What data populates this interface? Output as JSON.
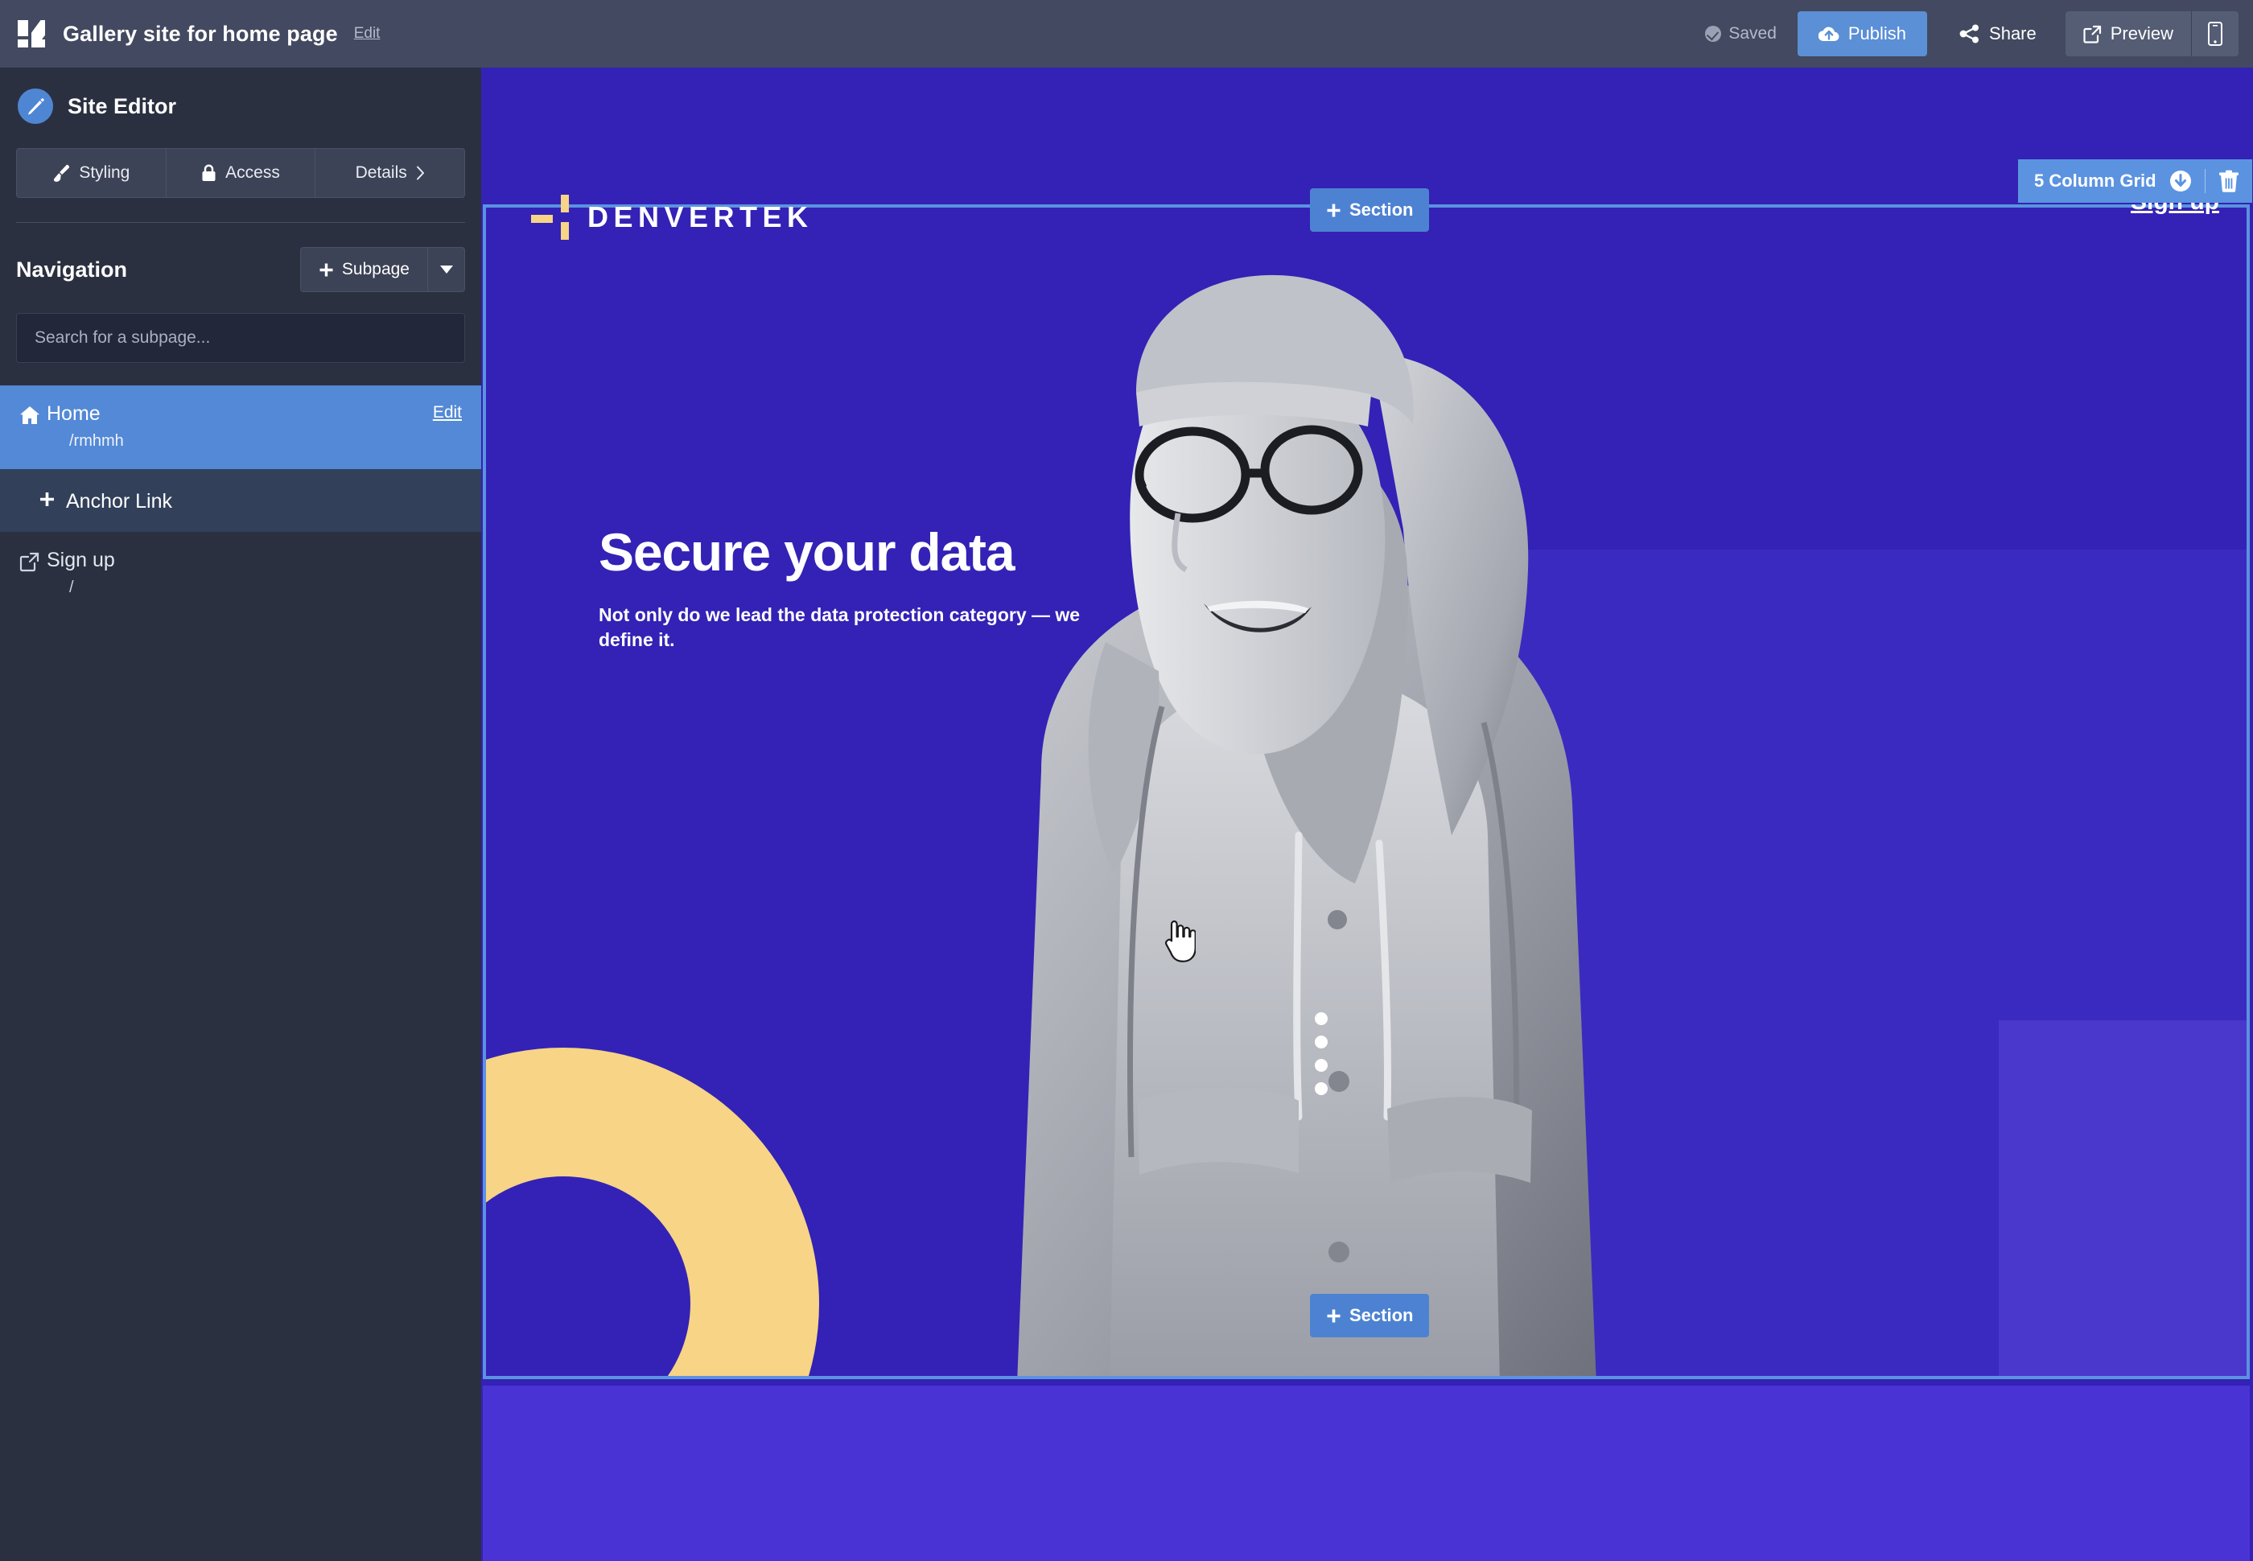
{
  "topbar": {
    "logo_icon": "app-grid-logo",
    "doc_title": "Gallery site for home page",
    "edit_link": "Edit",
    "saved_label": "Saved",
    "saved_icon": "check-circle-icon",
    "publish_label": "Publish",
    "publish_icon": "cloud-upload-icon",
    "share_label": "Share",
    "share_icon": "share-nodes-icon",
    "preview_label": "Preview",
    "preview_icon": "external-link-icon",
    "mobile_icon": "mobile-phone-icon",
    "accent": "#5b8fd6"
  },
  "sidebar": {
    "title": "Site Editor",
    "avatar_icon": "pencil-icon",
    "segments": [
      {
        "label": "Styling",
        "icon": "paintbrush-icon"
      },
      {
        "label": "Access",
        "icon": "lock-icon"
      },
      {
        "label": "Details",
        "icon": "chevron-right-icon"
      }
    ],
    "nav_title": "Navigation",
    "subpage_label": "Subpage",
    "subpage_icon": "plus-icon",
    "subpage_caret_icon": "caret-down-icon",
    "search_placeholder": "Search for a subpage...",
    "search_value": "",
    "rows": [
      {
        "label": "Home",
        "sub": "/rmhmh",
        "icon": "home-icon",
        "action": "Edit",
        "state": "selected"
      },
      {
        "label": "Anchor Link",
        "sub": "",
        "icon": "plus-icon",
        "action": "",
        "state": "add"
      },
      {
        "label": "Sign up",
        "sub": "/",
        "icon": "external-link-icon",
        "action": "",
        "state": "normal"
      }
    ]
  },
  "canvas": {
    "brand_name": "DENVERTEK",
    "brand_mark_icon": "denvertek-cross-mark",
    "nav_link": "Sign up",
    "hero_title": "Secure your data",
    "hero_subtitle": "Not only do we lead the data protection category — we define it.",
    "drag_handle_icon": "vertical-dots-drag-handle",
    "photo_alt_icon": "woman-in-hoodie-photo",
    "colors": {
      "hero_background": "#3322b5",
      "hero_panel": "#3b2ac0",
      "hero_panel_light": "#4a37cb",
      "lower_section": "#4a33d4",
      "arc_yellow": "#f7d486",
      "selection_border": "#5b93e0"
    }
  },
  "overlays": {
    "add_section_top": "Section",
    "add_section_bottom": "Section",
    "add_section_icon": "plus-icon",
    "grid_label": "5 Column Grid",
    "grid_move_icon": "move-down-circle-icon",
    "grid_delete_icon": "trash-icon",
    "cursor_icon": "pointing-hand-cursor"
  }
}
